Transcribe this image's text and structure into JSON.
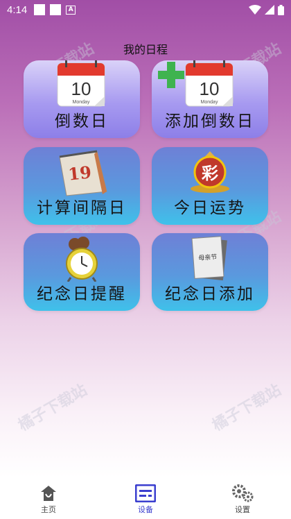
{
  "status_bar": {
    "time": "4:14",
    "notification_icon_letter": "A"
  },
  "page": {
    "title": "我的日程"
  },
  "tiles": [
    {
      "label": "倒数日",
      "icon": "calendar-icon",
      "icon_day": "10",
      "icon_weekday": "Monday"
    },
    {
      "label": "添加倒数日",
      "icon": "add-calendar-icon",
      "icon_day": "10",
      "icon_weekday": "Monday"
    },
    {
      "label": "计算间隔日",
      "icon": "desk-calendar-icon",
      "icon_day": "19"
    },
    {
      "label": "今日运势",
      "icon": "lottery-icon",
      "icon_text": "彩"
    },
    {
      "label": "纪念日提醒",
      "icon": "alarm-clock-icon"
    },
    {
      "label": "纪念日添加",
      "icon": "notebook-icon",
      "icon_text": "母亲节"
    }
  ],
  "watermark": "橘子下载站",
  "bottom_nav": [
    {
      "label": "主页",
      "icon": "home-icon",
      "active": false
    },
    {
      "label": "设备",
      "icon": "device-icon",
      "active": true
    },
    {
      "label": "设置",
      "icon": "settings-gear-icon",
      "active": false
    }
  ],
  "colors": {
    "nav_active": "#3b3fcf",
    "tile_purple": "#a79af0",
    "tile_blue": "#5a99de",
    "calendar_red": "#e23a2e"
  }
}
